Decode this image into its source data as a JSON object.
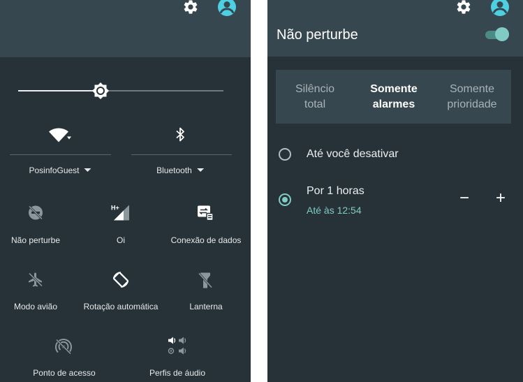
{
  "left_panel": {
    "brightness": {
      "level": 0.4
    },
    "wifi": {
      "label": "PosinfoGuest",
      "icon": "wifi-icon"
    },
    "bluetooth": {
      "label": "Bluetooth",
      "icon": "bluetooth-icon"
    },
    "tiles": [
      {
        "label": "Não perturbe",
        "icon": "do-not-disturb-icon"
      },
      {
        "label": "Oi",
        "icon": "cell-signal-hplus-icon",
        "network_badge": "H+"
      },
      {
        "label": "Conexão de dados",
        "icon": "data-connection-icon"
      },
      {
        "label": "Modo avião",
        "icon": "airplane-icon"
      },
      {
        "label": "Rotação automática",
        "icon": "auto-rotate-icon"
      },
      {
        "label": "Lanterna",
        "icon": "flashlight-off-icon"
      },
      {
        "label": "Ponto de acesso",
        "icon": "hotspot-icon"
      },
      {
        "label": "Perfis de áudio",
        "icon": "audio-profiles-icon"
      }
    ]
  },
  "right_panel": {
    "title": "Não perturbe",
    "toggle_on": true,
    "modes": [
      {
        "line1": "Silêncio",
        "line2": "total",
        "selected": false
      },
      {
        "line1": "Somente",
        "line2": "alarmes",
        "selected": true
      },
      {
        "line1": "Somente",
        "line2": "prioridade",
        "selected": false
      }
    ],
    "options": [
      {
        "label": "Até você desativar",
        "selected": false
      },
      {
        "label": "Por 1 horas",
        "sublabel": "Até às 12:54",
        "selected": true
      }
    ],
    "decrease_symbol": "−",
    "increase_symbol": "+"
  },
  "colors": {
    "panel_bg": "#263238",
    "header_bg": "#37474f",
    "accent": "#80cbc4",
    "account_icon": "#4dd0e1"
  }
}
